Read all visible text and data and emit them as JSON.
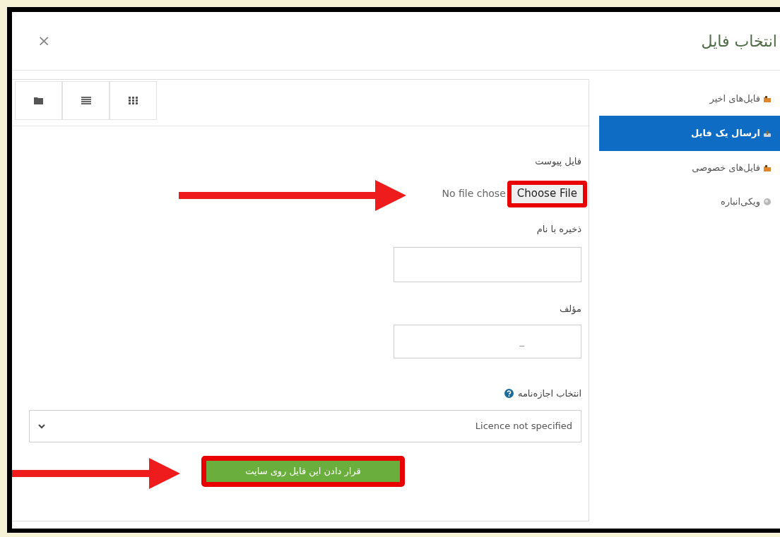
{
  "dialog": {
    "title": "انتخاب فایل",
    "close": "×"
  },
  "sidebar": {
    "items": [
      {
        "label": "فایل‌های اخیر",
        "kind": "recent",
        "selected": false
      },
      {
        "label": "ارسال یک فایل",
        "kind": "upload",
        "selected": true
      },
      {
        "label": "فایل‌های خصوصی",
        "kind": "private",
        "selected": false
      },
      {
        "label": "ویکی‌انباره",
        "kind": "wiki",
        "selected": false
      }
    ]
  },
  "form": {
    "attachment_label": "فایل پیوست",
    "file_status": "No file chose",
    "choose_button": "Choose File",
    "save_as_label": "ذخیره با نام",
    "author_label": "مؤلف",
    "author_value": "_",
    "license_label": "انتخاب اجازه‌نامه",
    "license_value": "Licence not specified",
    "submit_button": "قرار دادن این فایل روی سایت"
  }
}
